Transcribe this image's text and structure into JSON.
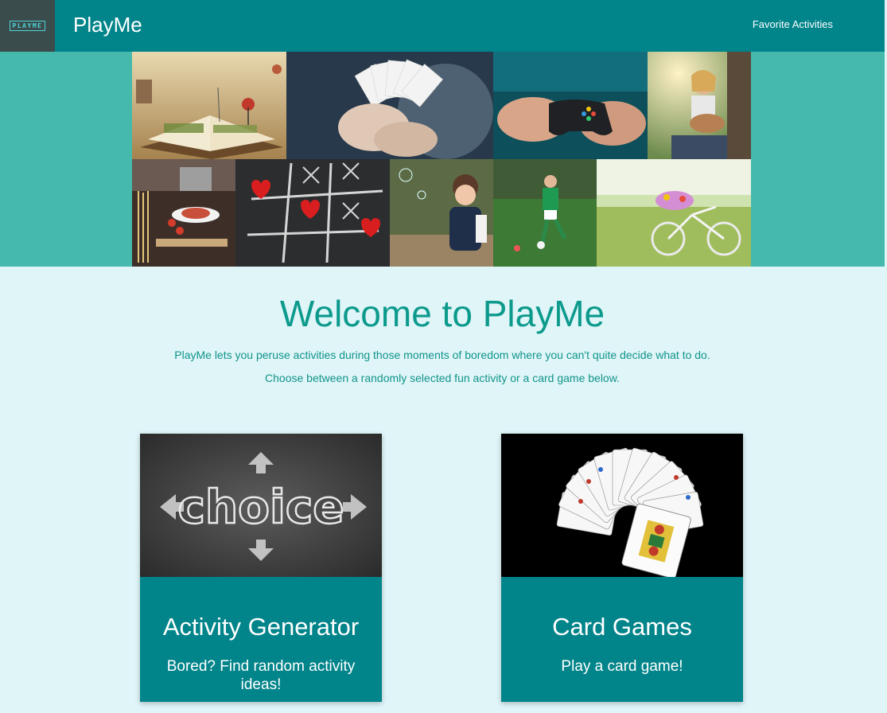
{
  "navbar": {
    "logo_text": "PLAYME",
    "brand": "PlayMe",
    "favorites_link": "Favorite Activities"
  },
  "hero": {
    "images": [
      "book-landscape-photo",
      "playing-cards-hand-photo",
      "game-controller-photo",
      "woman-guitar-photo",
      "cooking-pasta-photo",
      "tic-tac-toe-hearts-photo",
      "child-bubbles-photo",
      "boy-soccer-photo",
      "bicycle-meadow-photo"
    ]
  },
  "welcome": {
    "title": "Welcome to PlayMe",
    "line1": "PlayMe lets you peruse activities during those moments of boredom where you can't quite decide what to do.",
    "line2": "Choose between a randomly selected fun activity or a card game below."
  },
  "cards": [
    {
      "title": "Activity Generator",
      "text": "Bored? Find random activity ideas!",
      "image_text": "choice",
      "icon": "chalkboard-choice-image"
    },
    {
      "title": "Card Games",
      "text": "Play a card game!",
      "icon": "fanned-cards-image"
    }
  ],
  "colors": {
    "primary": "#01848a",
    "hero_bg": "#46b9ad",
    "page_bg": "#dff5f8",
    "heading": "#0c9a8c"
  }
}
